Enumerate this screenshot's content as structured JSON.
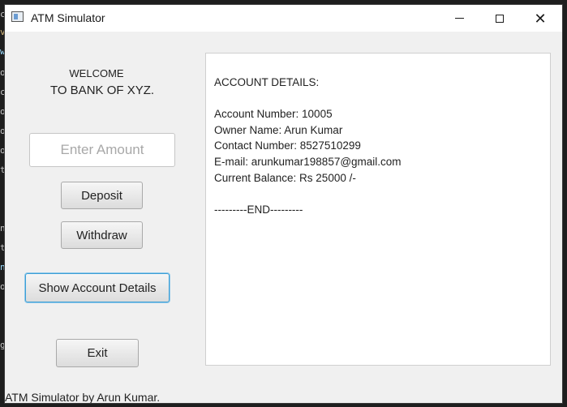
{
  "window": {
    "title": "ATM Simulator",
    "controls": [
      "minimize",
      "maximize",
      "close"
    ],
    "close_glyph": "✕"
  },
  "welcome": {
    "line1": "WELCOME",
    "line2": "TO BANK OF XYZ."
  },
  "amount_input": {
    "placeholder": "Enter Amount",
    "value": ""
  },
  "buttons": {
    "deposit": "Deposit",
    "withdraw": "Withdraw",
    "show_account_details": "Show Account Details",
    "exit": "Exit"
  },
  "account_details": {
    "heading": "ACCOUNT DETAILS:",
    "account_number": "Account Number: 10005",
    "owner_name": "Owner Name: Arun Kumar",
    "contact_number": "Contact Number: 8527510299",
    "email": "E-mail: arunkumar198857@gmail.com",
    "current_balance": "Current Balance: Rs 25000 /-",
    "end_marker": "---------END---------"
  },
  "status_bar": {
    "text": "ATM Simulator by Arun Kumar."
  },
  "background_editor_chars": [
    "c",
    "v",
    "w",
    "o",
    "c",
    "o",
    "o",
    "o",
    "t",
    "n",
    "t",
    "n",
    "o",
    "g"
  ],
  "colors": {
    "window_bg": "#f0f0f0",
    "titlebar_bg": "#ffffff",
    "focus_border": "#3c9fd6",
    "panel_bg": "#ffffff"
  }
}
